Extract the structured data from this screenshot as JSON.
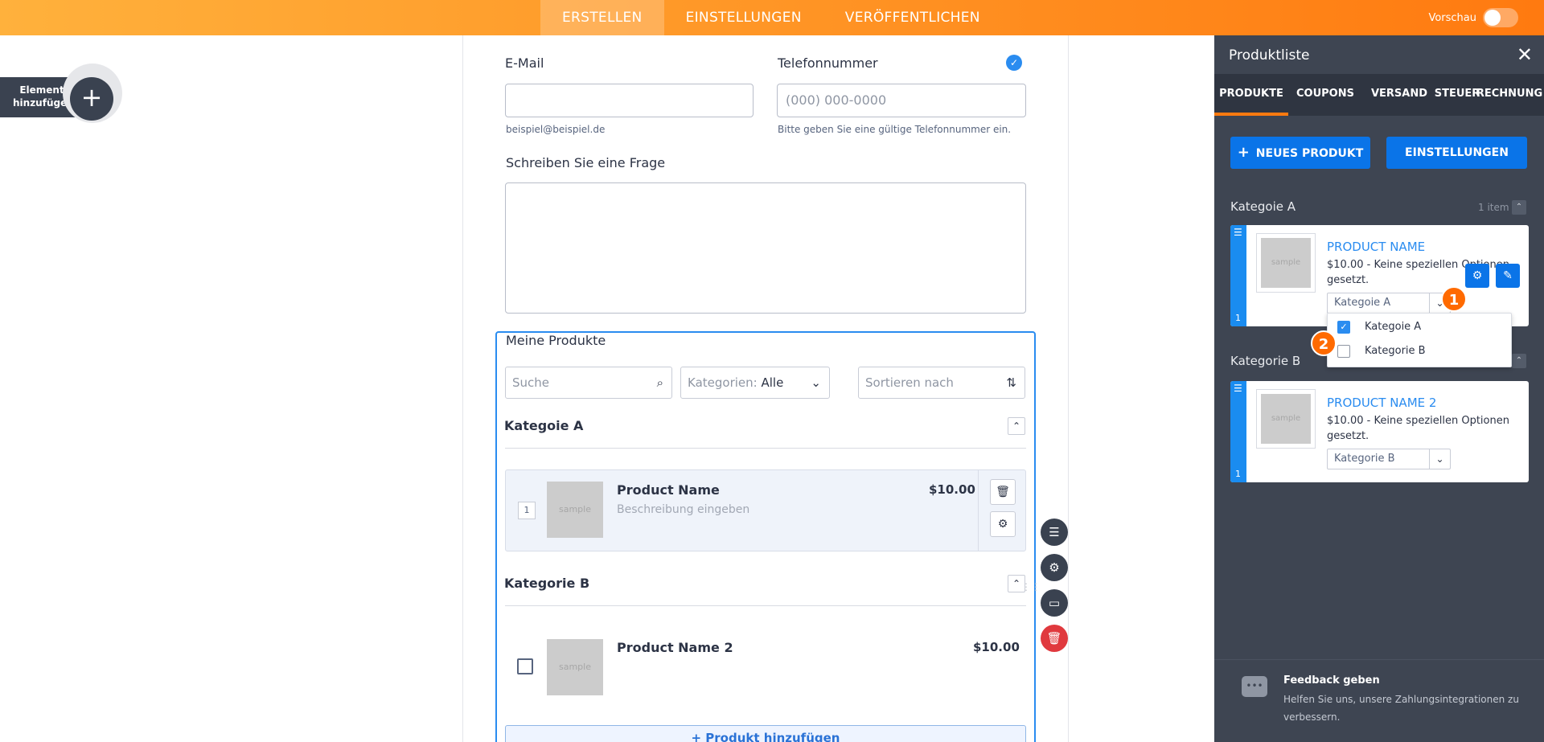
{
  "topbar": {
    "tabs": [
      "ERSTELLEN",
      "EINSTELLUNGEN",
      "VERÖFFENTLICHEN"
    ],
    "active_tab": "ERSTELLEN",
    "preview_label": "Vorschau",
    "gradient_colors": [
      "#ffb13c",
      "#ff7a10"
    ]
  },
  "sidebar_left": {
    "add_element_label": "Element hinzufügen",
    "add_icon": "plus-icon"
  },
  "form": {
    "email_label": "E-Mail",
    "email_value": "",
    "email_hint": "beispiel@beispiel.de",
    "phone_label": "Telefonnummer",
    "phone_placeholder": "(000) 000-0000",
    "phone_hint": "Bitte geben Sie eine gültige Telefonnummer ein.",
    "question_label": "Schreiben Sie eine Frage"
  },
  "products_widget": {
    "title": "Meine Produkte",
    "search_placeholder": "Suche",
    "categories_label": "Kategorien:",
    "categories_value": "Alle",
    "sort_placeholder": "Sortieren nach",
    "add_product_label": "+ Produkt hinzufügen",
    "categories": [
      {
        "name": "Kategoie A",
        "products": [
          {
            "qty": "1",
            "name": "Product Name",
            "price": "$10.00",
            "description": "Beschreibung eingeben",
            "image_label": "sample"
          }
        ]
      },
      {
        "name": "Kategorie B",
        "products": [
          {
            "name": "Product Name 2",
            "price": "$10.00",
            "image_label": "sample"
          }
        ]
      }
    ]
  },
  "panel": {
    "title": "Produktliste",
    "tabs": [
      "PRODUKTE",
      "COUPONS",
      "VERSAND",
      "STEUER",
      "RECHNUNG"
    ],
    "active_tab": "PRODUKTE",
    "new_product_label": "NEUES PRODUKT",
    "settings_label": "EINSTELLUNGEN",
    "categories": [
      {
        "name": "Kategoie A",
        "count": "1 item",
        "card": {
          "name": "PRODUCT NAME",
          "description": "$10.00 - Keine speziellen Optionen gesetzt.",
          "category": "Kategoie A",
          "number": "1",
          "image_label": "sample"
        }
      },
      {
        "name": "Kategorie B",
        "card": {
          "name": "PRODUCT NAME 2",
          "description": "$10.00 - Keine speziellen Optionen gesetzt.",
          "category": "Kategorie B",
          "number": "1",
          "image_label": "sample"
        }
      }
    ],
    "dropdown_options": [
      {
        "label": "Kategoie A",
        "checked": true
      },
      {
        "label": "Kategorie B",
        "checked": false
      }
    ],
    "badges": [
      "1",
      "2"
    ],
    "feedback_title": "Feedback geben",
    "feedback_text": "Helfen Sie uns, unsere Zahlungsintegrationen zu verbessern.",
    "accent_color": "#0a74e8"
  }
}
